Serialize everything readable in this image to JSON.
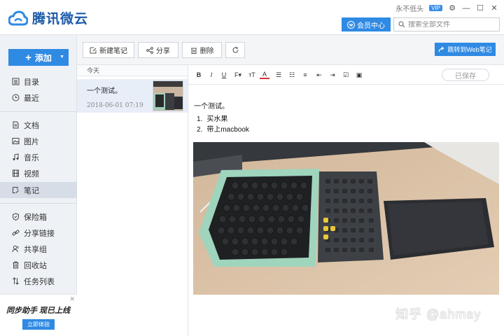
{
  "app": {
    "name": "腾讯微云",
    "status_text": "永不低头",
    "vip_badge": "VIP"
  },
  "header": {
    "member_label": "会员中心",
    "search_placeholder": "搜索全部文件"
  },
  "sidebar": {
    "add_label": "添加",
    "items": [
      {
        "label": "目录",
        "icon": "directory-icon"
      },
      {
        "label": "最近",
        "icon": "clock-icon"
      },
      {
        "label": "文档",
        "icon": "document-icon"
      },
      {
        "label": "图片",
        "icon": "image-icon"
      },
      {
        "label": "音乐",
        "icon": "music-icon"
      },
      {
        "label": "视频",
        "icon": "video-icon"
      },
      {
        "label": "笔记",
        "icon": "note-icon",
        "active": true
      },
      {
        "label": "保险箱",
        "icon": "shield-icon"
      },
      {
        "label": "分享链接",
        "icon": "link-icon"
      },
      {
        "label": "共享组",
        "icon": "group-icon"
      },
      {
        "label": "回收站",
        "icon": "trash-icon"
      },
      {
        "label": "任务列表",
        "icon": "transfer-icon"
      }
    ],
    "promo": {
      "title": "同步助手 现已上线",
      "button": "立即体验"
    }
  },
  "toolbar": {
    "new_note": "新建笔记",
    "share": "分享",
    "delete": "删除",
    "web_note": "跳转到Web笔记"
  },
  "note_list": {
    "group_label": "今天",
    "notes": [
      {
        "title": "一个测试。",
        "date": "2018-06-01 07:19"
      }
    ]
  },
  "editor": {
    "saved_label": "已保存",
    "doc_title": "一个测试。",
    "list_items": [
      "买水果",
      "带上macbook"
    ],
    "watermark": "知乎 @ahmay"
  },
  "colors": {
    "accent": "#2f8ae3",
    "brand": "#1c5aa8",
    "sidebar_bg": "#eef1f5"
  }
}
